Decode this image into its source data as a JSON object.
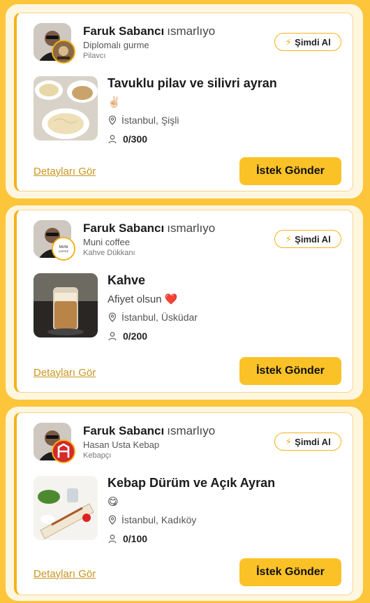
{
  "cards": [
    {
      "sponsor": "Faruk Sabancı",
      "verb": "ısmarlıyo",
      "venue": "Diplomalı gurme",
      "venue_type": "Pilavcı",
      "now_label": "Şimdi Al",
      "title": "Tavuklu pilav ve silivri ayran",
      "note": "✌🏻",
      "location": "İstanbul, Şişli",
      "capacity": "0/300",
      "details_label": "Detayları Gör",
      "send_label": "İstek Gönder",
      "logo_icon": "restaurant-logo-icon",
      "thumb": "pilav-food-photo"
    },
    {
      "sponsor": "Faruk Sabancı",
      "verb": "ısmarlıyo",
      "venue": "Muni coffee",
      "venue_type": "Kahve Dükkanı",
      "now_label": "Şimdi Al",
      "title": "Kahve",
      "note": "Afiyet olsun ❤️",
      "location": "İstanbul, Üsküdar",
      "capacity": "0/200",
      "details_label": "Detayları Gör",
      "send_label": "İstek Gönder",
      "logo_text": "MUNI COFFEE",
      "thumb": "iced-coffee-photo"
    },
    {
      "sponsor": "Faruk Sabancı",
      "verb": "ısmarlıyo",
      "venue": "Hasan Usta Kebap",
      "venue_type": "Kebapçı",
      "now_label": "Şimdi Al",
      "title": "Kebap Dürüm ve Açık Ayran",
      "note": "😋",
      "location": "İstanbul, Kadıköy",
      "capacity": "0/100",
      "details_label": "Detayları Gör",
      "send_label": "İstek Gönder",
      "logo_text": "H",
      "thumb": "durum-food-photo"
    }
  ],
  "colors": {
    "accent": "#fbc228",
    "link": "#c9961f",
    "background": "#fdc53a"
  }
}
